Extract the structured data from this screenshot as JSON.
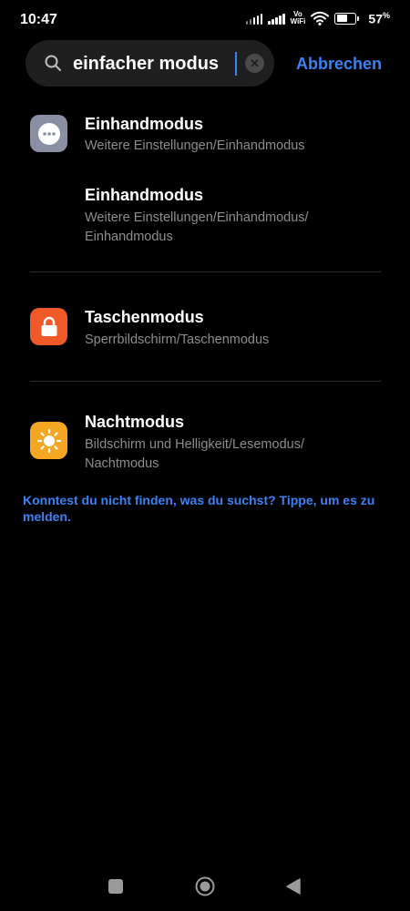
{
  "status": {
    "time": "10:47",
    "volte_top": "Vo",
    "volte_bottom": "WiFi",
    "battery_level": 0.57,
    "battery_percent": "57",
    "percent_sign": "%"
  },
  "search": {
    "query": "einfacher modus",
    "cancel_label": "Abbrechen",
    "icons": {
      "search": "search-icon",
      "clear": "clear-icon"
    }
  },
  "results": [
    {
      "title": "Einhandmodus",
      "path": "Weitere Einstellungen/Einhandmodus",
      "icon": "more-dots-icon",
      "icon_color": "#8a8fa3"
    },
    {
      "title": "Einhandmodus",
      "path": "Weitere Einstellungen/Einhandmodus/ Einhandmodus",
      "icon": "",
      "icon_color": ""
    },
    {
      "title": "Taschenmodus",
      "path": "Sperrbildschirm/Taschenmodus",
      "icon": "lock-icon",
      "icon_color": "#f05a28"
    },
    {
      "title": "Nachtmodus",
      "path": "Bildschirm und Helligkeit/Lesemodus/ Nachtmodus",
      "icon": "sun-icon",
      "icon_color": "#f5a623"
    }
  ],
  "feedback_text": "Konntest du nicht finden, was du suchst? Tippe, um es zu melden.",
  "colors": {
    "accent": "#3b82f6",
    "background": "#000000",
    "search_bg": "#1f1f1f"
  },
  "nav": {
    "icons": [
      "recents-square-icon",
      "home-circle-icon",
      "back-triangle-icon"
    ]
  }
}
